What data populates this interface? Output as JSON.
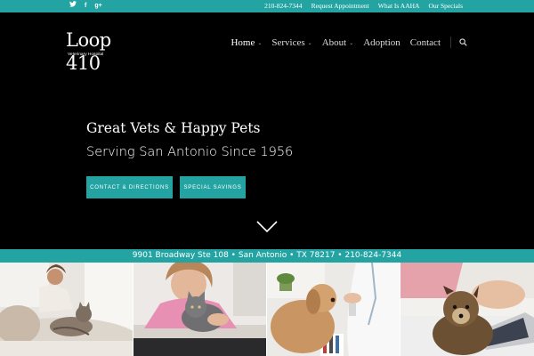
{
  "topbar": {
    "social": [
      {
        "icon": "twitter-icon",
        "glyph": "𝕥"
      },
      {
        "icon": "facebook-icon",
        "glyph": "f"
      },
      {
        "icon": "google-plus-icon",
        "glyph": "g+"
      }
    ],
    "phone": "210-824-7344",
    "links": [
      "Request Appointment",
      "What Is AAHA",
      "Our Specials"
    ]
  },
  "logo": {
    "text": "Loop 410",
    "subtitle": "Veterinary Hospital"
  },
  "nav": {
    "items": [
      {
        "label": "Home",
        "dropdown": true,
        "active": true
      },
      {
        "label": "Services",
        "dropdown": true,
        "active": false
      },
      {
        "label": "About",
        "dropdown": true,
        "active": false
      },
      {
        "label": "Adoption",
        "dropdown": false,
        "active": false
      },
      {
        "label": "Contact",
        "dropdown": false,
        "active": false
      }
    ],
    "search_icon": "search-icon"
  },
  "hero": {
    "headline": "Great Vets & Happy Pets",
    "subheadline": "Serving San Antonio Since 1956",
    "buttons": {
      "contact": "CONTACT & DIRECTIONS",
      "special": "SPECIAL SAVINGS"
    },
    "scroll_icon": "chevron-down-icon"
  },
  "address": "9901 Broadway Ste 108 • San Antonio • TX 78217 • 210-824-7344",
  "photos": [
    {
      "subject": "woman-with-cat"
    },
    {
      "subject": "girl-with-kitten"
    },
    {
      "subject": "vet-with-dog"
    },
    {
      "subject": "puppy-with-laptop"
    }
  ],
  "colors": {
    "accent": "#23a4a2",
    "background": "#000000",
    "text": "#ffffff"
  }
}
